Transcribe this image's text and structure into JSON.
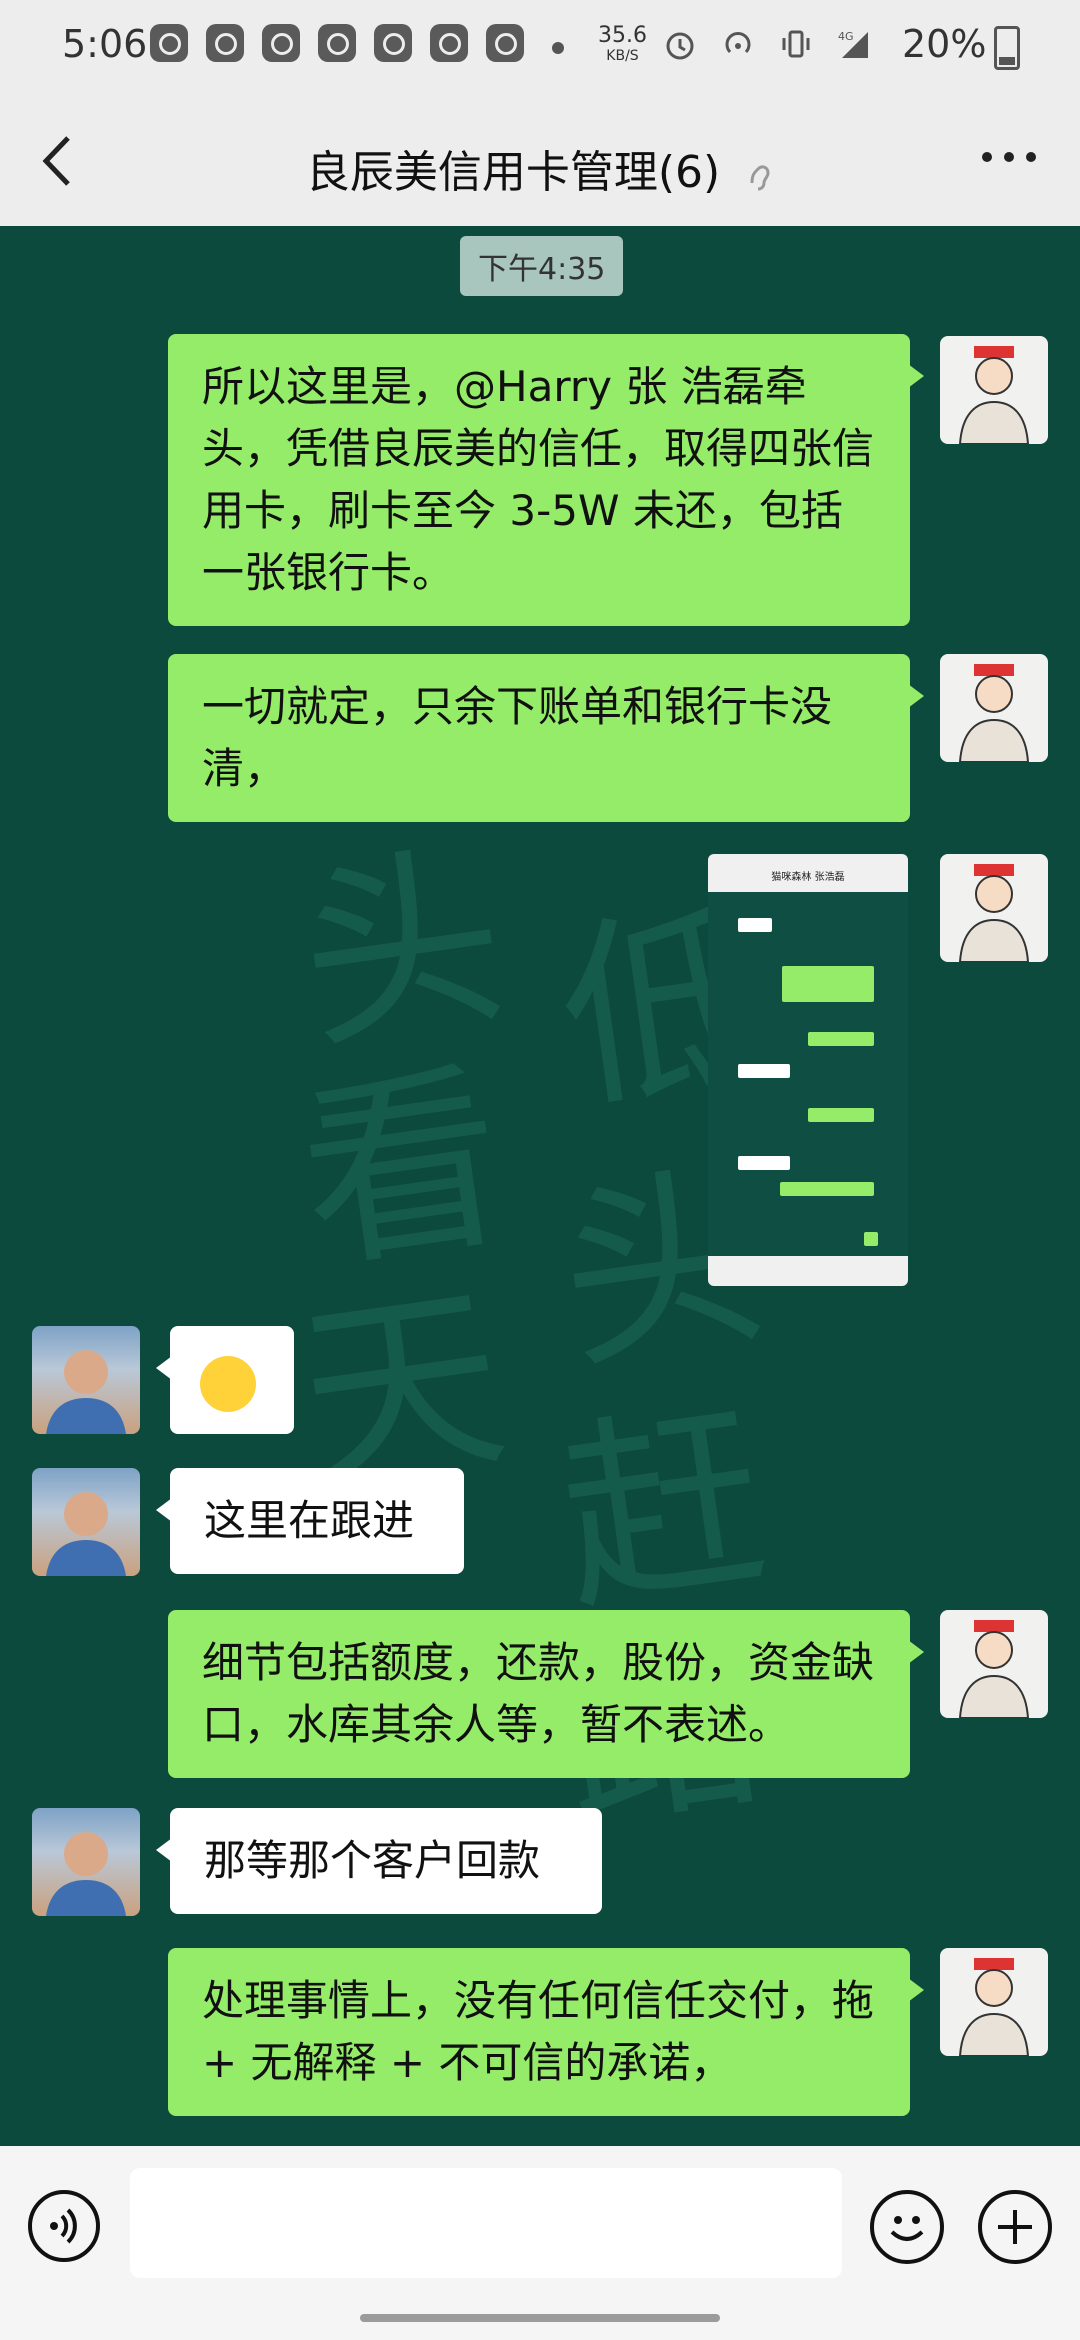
{
  "status_bar": {
    "time": "5:06",
    "net_speed_value": "35.6",
    "net_speed_unit": "KB/S",
    "network": "4G",
    "battery": "20%"
  },
  "header": {
    "title": "良辰美信用卡管理(6)"
  },
  "chat": {
    "timestamp": "下午4:35",
    "messages": [
      {
        "side": "me",
        "type": "text",
        "text": "所以这里是，@Harry 张  浩磊牵头，凭借良辰美的信任，取得四张信用卡，刷卡至今 3-5W 未还，包括一张银行卡。"
      },
      {
        "side": "me",
        "type": "text",
        "text": "一切就定，只余下账单和银行卡没清，"
      },
      {
        "side": "me",
        "type": "image",
        "title": "猫咪森林  张浩磊"
      },
      {
        "side": "other",
        "type": "emoji",
        "emoji": "facepalm"
      },
      {
        "side": "other",
        "type": "text",
        "text": "这里在跟进"
      },
      {
        "side": "me",
        "type": "text",
        "text": "细节包括额度，还款，股份，资金缺口，水库其余人等，暂不表述。"
      },
      {
        "side": "other",
        "type": "text",
        "text": "那等那个客户回款"
      },
      {
        "side": "me",
        "type": "text",
        "text": "处理事情上，没有任何信任交付，拖 + 无解释 + 不可信的承诺，"
      }
    ]
  },
  "background_text": [
    "头",
    "看",
    "天",
    "低",
    "头",
    "赶",
    "路"
  ],
  "colors": {
    "chat_bg": "#0d4a3e",
    "my_bubble": "#95ec69",
    "other_bubble": "#ffffff",
    "bar_bg": "#ededed"
  },
  "input_bar": {
    "icons": [
      "voice-icon",
      "emoji-icon",
      "plus-icon"
    ]
  }
}
